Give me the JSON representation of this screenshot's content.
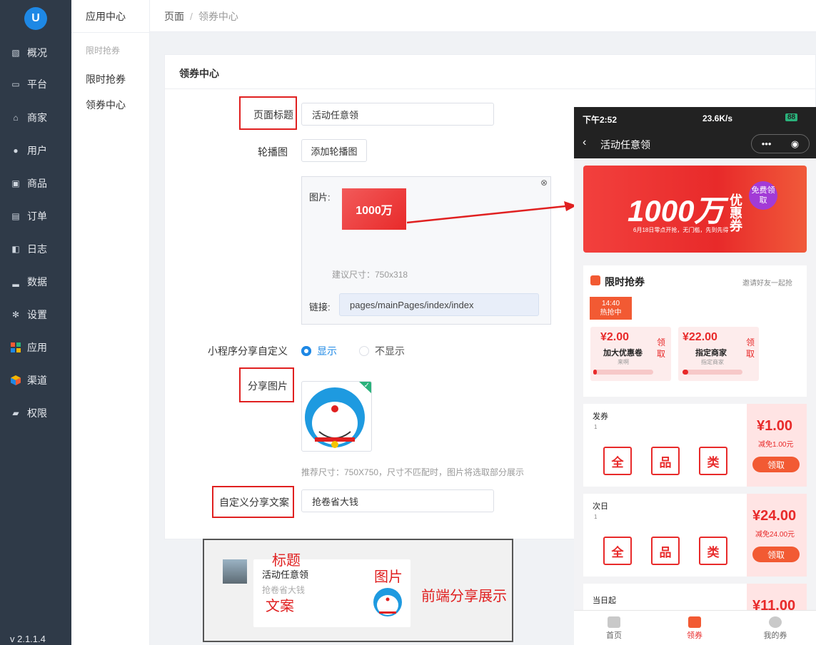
{
  "sidebar": {
    "logo_text": "U",
    "items": [
      {
        "label": "概况",
        "icon": "chart-icon"
      },
      {
        "label": "平台",
        "icon": "monitor-icon"
      },
      {
        "label": "商家",
        "icon": "store-icon"
      },
      {
        "label": "用户",
        "icon": "user-icon"
      },
      {
        "label": "商品",
        "icon": "bag-icon"
      },
      {
        "label": "订单",
        "icon": "clipboard-icon"
      },
      {
        "label": "日志",
        "icon": "book-icon"
      },
      {
        "label": "数据",
        "icon": "bar-chart-icon"
      },
      {
        "label": "设置",
        "icon": "gear-icon"
      },
      {
        "label": "应用",
        "icon": "apps-grid-icon"
      },
      {
        "label": "渠道",
        "icon": "cube-icon"
      },
      {
        "label": "权限",
        "icon": "lock-icon"
      }
    ],
    "version": "v 2.1.1.4"
  },
  "subnav": {
    "title": "应用中心",
    "group": "限时抢券",
    "items": [
      "限时抢券",
      "领券中心"
    ]
  },
  "breadcrumb": {
    "root": "页面",
    "sep": "/",
    "current": "领券中心"
  },
  "card": {
    "title": "领券中心",
    "page_title_label": "页面标题",
    "page_title_value": "活动任意领",
    "carousel_label": "轮播图",
    "add_carousel_button": "添加轮播图",
    "image_label": "图片:",
    "suggest_size": "建议尺寸：750x318",
    "link_label": "链接:",
    "link_value": "pages/mainPages/index/index",
    "share_custom_label": "小程序分享自定义",
    "radio_show": "显示",
    "radio_hide": "不显示",
    "share_image_label": "分享图片",
    "share_image_hint": "推荐尺寸：750X750，尺寸不匹配时，图片将选取部分展示",
    "share_text_label": "自定义分享文案",
    "share_text_value": "抢卷省大钱"
  },
  "phone": {
    "status_time": "下午2:52",
    "status_right": "23.6K/s",
    "battery": "88",
    "nav_title": "活动任意领",
    "banner_big": "1000万",
    "banner_side": "优惠券",
    "banner_badge": "免费领取",
    "banner_sub": "6月18日零点开抢，无门槛，先到先得",
    "flash_title": "限时抢券",
    "invite": "邀请好友一起抢",
    "time": "14:40",
    "hot": "热抢中",
    "flash_coupons": [
      {
        "price": "2.00",
        "name": "加大优惠卷",
        "sub": "来啊",
        "progress": 0.06,
        "action": "领取"
      },
      {
        "price": "22.00",
        "name": "指定商家",
        "sub": "指定商家",
        "progress": 0.1,
        "action": "领取"
      }
    ],
    "coupons": [
      {
        "title": "发券",
        "count": "1",
        "price": "1.00",
        "desc": "减免1.00元",
        "action": "领取"
      },
      {
        "title": "次日",
        "count": "1",
        "price": "24.00",
        "desc": "减免24.00元",
        "action": "领取"
      },
      {
        "title": "当日起",
        "price": "11.00"
      }
    ],
    "scope_tags": [
      "全",
      "品",
      "类"
    ],
    "tabs": [
      "首页",
      "领券",
      "我的券"
    ]
  },
  "share_preview": {
    "title": "活动任意领",
    "text": "抢卷省大钱",
    "ann_title": "标题",
    "ann_text": "文案",
    "ann_image": "图片",
    "ann_caption": "前端分享展示"
  },
  "colors": {
    "accent": "#1e88e5",
    "red": "#e82a2a",
    "nav_bg": "#2f3a48"
  }
}
